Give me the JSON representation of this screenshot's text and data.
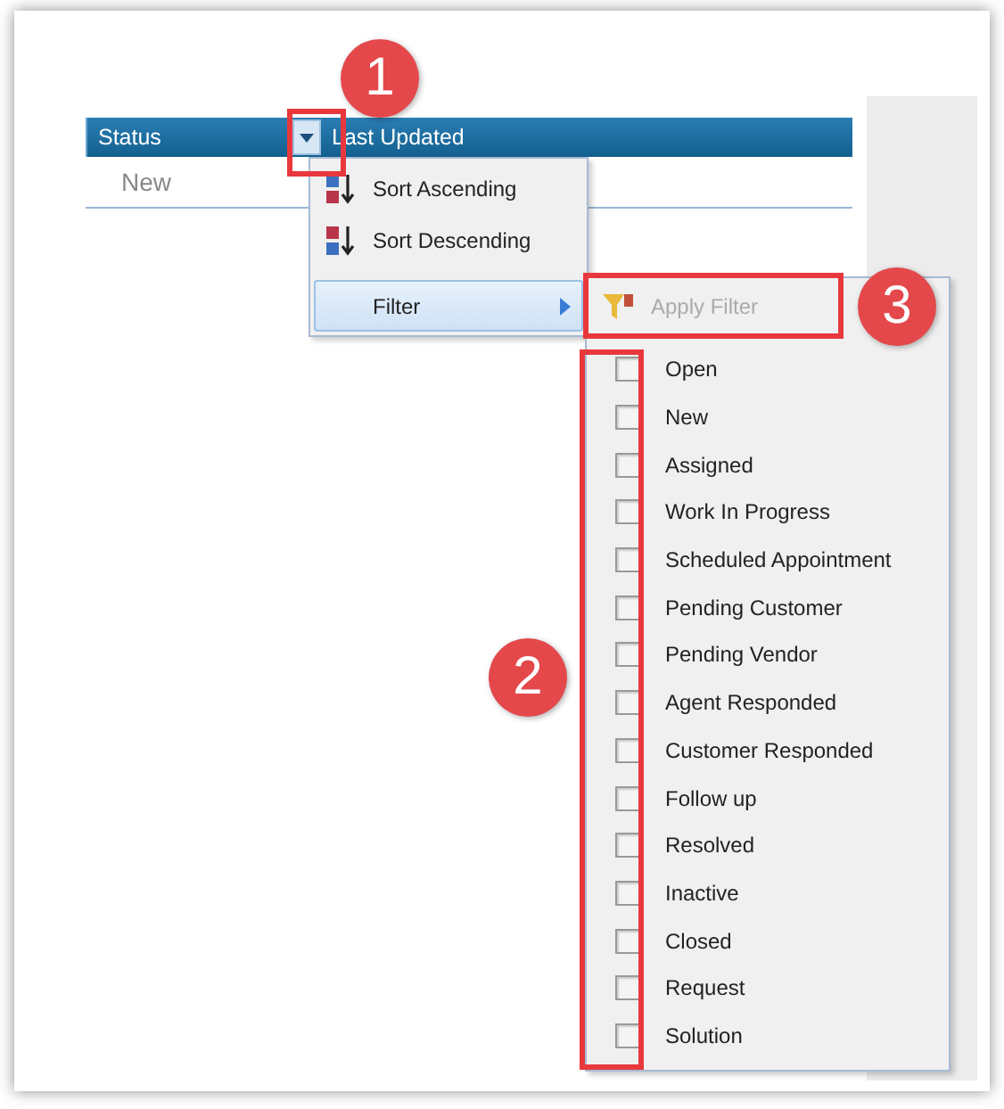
{
  "table": {
    "columns": [
      {
        "label": "Status"
      },
      {
        "label": "Last Updated"
      }
    ],
    "rows": [
      {
        "status": "New"
      }
    ]
  },
  "menu": {
    "items": [
      {
        "kind": "sort-asc",
        "label": "Sort Ascending",
        "selected": false
      },
      {
        "kind": "sort-desc",
        "label": "Sort Descending",
        "selected": false
      },
      {
        "kind": "submenu",
        "label": "Filter",
        "selected": true
      }
    ]
  },
  "filter_menu": {
    "apply": {
      "label": "Apply Filter",
      "disabled": true
    },
    "options": [
      {
        "label": "Open",
        "checked": false
      },
      {
        "label": "New",
        "checked": false
      },
      {
        "label": "Assigned",
        "checked": false
      },
      {
        "label": "Work In Progress",
        "checked": false
      },
      {
        "label": "Scheduled Appointment",
        "checked": false
      },
      {
        "label": "Pending Customer",
        "checked": false
      },
      {
        "label": "Pending Vendor",
        "checked": false
      },
      {
        "label": "Agent Responded",
        "checked": false
      },
      {
        "label": "Customer Responded",
        "checked": false
      },
      {
        "label": "Follow up",
        "checked": false
      },
      {
        "label": "Resolved",
        "checked": false
      },
      {
        "label": "Inactive",
        "checked": false
      },
      {
        "label": "Closed",
        "checked": false
      },
      {
        "label": "Request",
        "checked": false
      },
      {
        "label": "Solution",
        "checked": false
      }
    ]
  },
  "annotations": [
    {
      "label": "1"
    },
    {
      "label": "2"
    },
    {
      "label": "3"
    }
  ]
}
